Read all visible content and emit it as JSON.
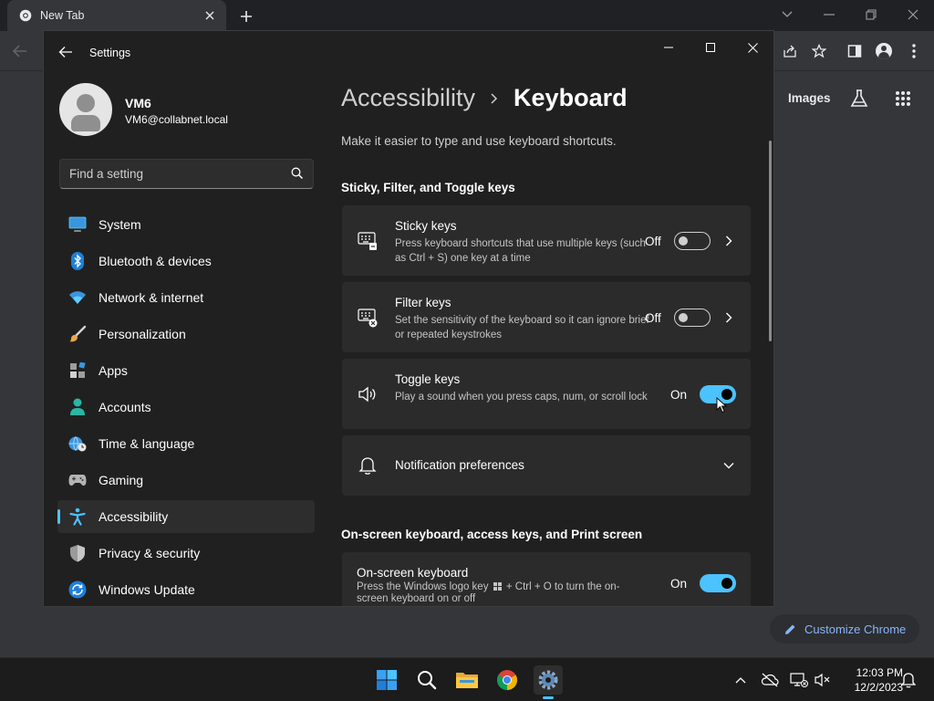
{
  "chrome": {
    "tab_title": "New Tab",
    "images_link": "Images",
    "customize_label": "Customize Chrome",
    "accent": "#8ab4f8"
  },
  "settings": {
    "title": "Settings",
    "profile": {
      "name": "VM6",
      "email": "VM6@collabnet.local"
    },
    "search": {
      "placeholder": "Find a setting"
    },
    "nav": [
      {
        "label": "System",
        "icon": "system-icon"
      },
      {
        "label": "Bluetooth & devices",
        "icon": "bluetooth-icon"
      },
      {
        "label": "Network & internet",
        "icon": "network-icon"
      },
      {
        "label": "Personalization",
        "icon": "brush-icon"
      },
      {
        "label": "Apps",
        "icon": "apps-icon"
      },
      {
        "label": "Accounts",
        "icon": "accounts-icon"
      },
      {
        "label": "Time & language",
        "icon": "globe-clock-icon"
      },
      {
        "label": "Gaming",
        "icon": "gamepad-icon"
      },
      {
        "label": "Accessibility",
        "icon": "accessibility-icon",
        "selected": true
      },
      {
        "label": "Privacy & security",
        "icon": "shield-icon"
      },
      {
        "label": "Windows Update",
        "icon": "update-icon"
      }
    ],
    "breadcrumb": {
      "parent": "Accessibility",
      "current": "Keyboard"
    },
    "description": "Make it easier to type and use keyboard shortcuts.",
    "sections": {
      "s1": "Sticky, Filter, and Toggle keys",
      "s2": "On-screen keyboard, access keys, and Print screen"
    },
    "items": {
      "sticky": {
        "title": "Sticky keys",
        "desc": "Press keyboard shortcuts that use multiple keys (such as Ctrl + S) one key at a time",
        "state": "Off",
        "on": false
      },
      "filter": {
        "title": "Filter keys",
        "desc": "Set the sensitivity of the keyboard so it can ignore brief or repeated keystrokes",
        "state": "Off",
        "on": false
      },
      "toggle": {
        "title": "Toggle keys",
        "desc": "Play a sound when you press caps, num, or scroll lock",
        "state": "On",
        "on": true
      },
      "notifications": {
        "title": "Notification preferences"
      },
      "osk": {
        "title": "On-screen keyboard",
        "desc_before": "Press the Windows logo key",
        "desc_after": "+ Ctrl + O to turn the on-screen keyboard on or off",
        "state": "On",
        "on": true
      }
    },
    "accent": "#4cc2ff"
  },
  "taskbar": {
    "apps": [
      "start-icon",
      "search-icon",
      "file-explorer-icon",
      "chrome-icon",
      "settings-icon"
    ],
    "active_app": "settings-icon",
    "time": "12:03 PM",
    "date": "12/2/2023"
  }
}
